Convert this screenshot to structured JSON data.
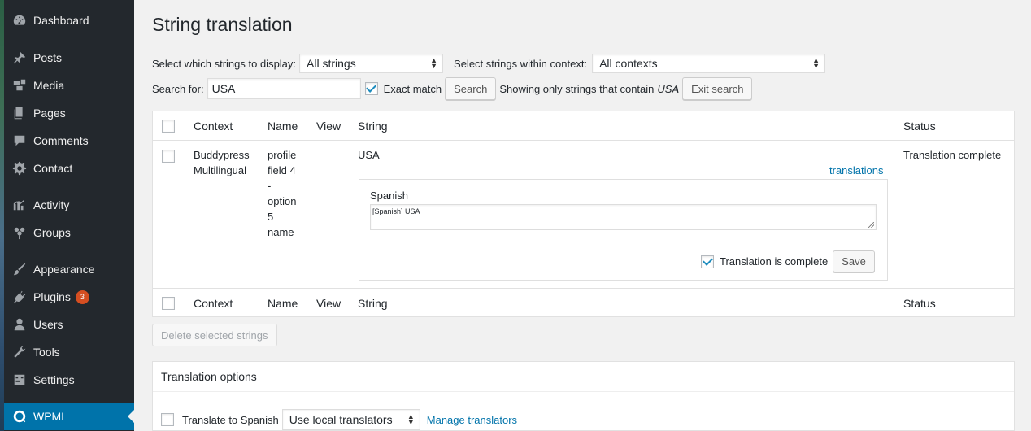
{
  "sidebar": {
    "items": [
      {
        "label": "Dashboard",
        "icon": "dashboard-icon"
      },
      {
        "label": "Posts",
        "icon": "pin-icon"
      },
      {
        "label": "Media",
        "icon": "media-icon"
      },
      {
        "label": "Pages",
        "icon": "pages-icon"
      },
      {
        "label": "Comments",
        "icon": "comment-icon"
      },
      {
        "label": "Contact",
        "icon": "gear-icon"
      },
      {
        "label": "Activity",
        "icon": "activity-icon"
      },
      {
        "label": "Groups",
        "icon": "groups-icon"
      },
      {
        "label": "Appearance",
        "icon": "brush-icon"
      },
      {
        "label": "Plugins",
        "icon": "plug-icon",
        "badge": "3"
      },
      {
        "label": "Users",
        "icon": "user-icon"
      },
      {
        "label": "Tools",
        "icon": "wrench-icon"
      },
      {
        "label": "Settings",
        "icon": "settings-icon"
      },
      {
        "label": "WPML",
        "icon": "wpml-icon",
        "active": true
      }
    ]
  },
  "page": {
    "title": "String translation"
  },
  "filters": {
    "display_label": "Select which strings to display:",
    "display_value": "All strings",
    "context_label": "Select strings within context:",
    "context_value": "All contexts"
  },
  "search": {
    "label": "Search for:",
    "value": "USA",
    "exact_match_label": "Exact match",
    "exact_match_checked": true,
    "button": "Search",
    "showing_text": "Showing only strings that contain",
    "showing_term": "USA",
    "exit_button": "Exit search"
  },
  "table": {
    "headers": {
      "context": "Context",
      "name": "Name",
      "view": "View",
      "string": "String",
      "status": "Status"
    },
    "rows": [
      {
        "context_line1": "Buddypress",
        "context_line2": "Multilingual",
        "name_lines": [
          "profile",
          "field 4",
          "-",
          "option",
          "5",
          "name"
        ],
        "view": "",
        "string": "USA",
        "translations_link": "translations",
        "status": "Translation complete",
        "translation": {
          "language": "Spanish",
          "value": "[Spanish] USA",
          "complete_label": "Translation is complete",
          "complete_checked": true,
          "save_button": "Save"
        }
      }
    ]
  },
  "actions": {
    "delete_button": "Delete selected strings"
  },
  "translation_options": {
    "heading": "Translation options",
    "translate_to_label": "Translate to Spanish",
    "translator_select": "Use local translators",
    "manage_link": "Manage translators"
  },
  "colors": {
    "sidebar_bg": "#23282d",
    "active_bg": "#0073aa",
    "link": "#0073aa",
    "badge": "#d54e21"
  }
}
